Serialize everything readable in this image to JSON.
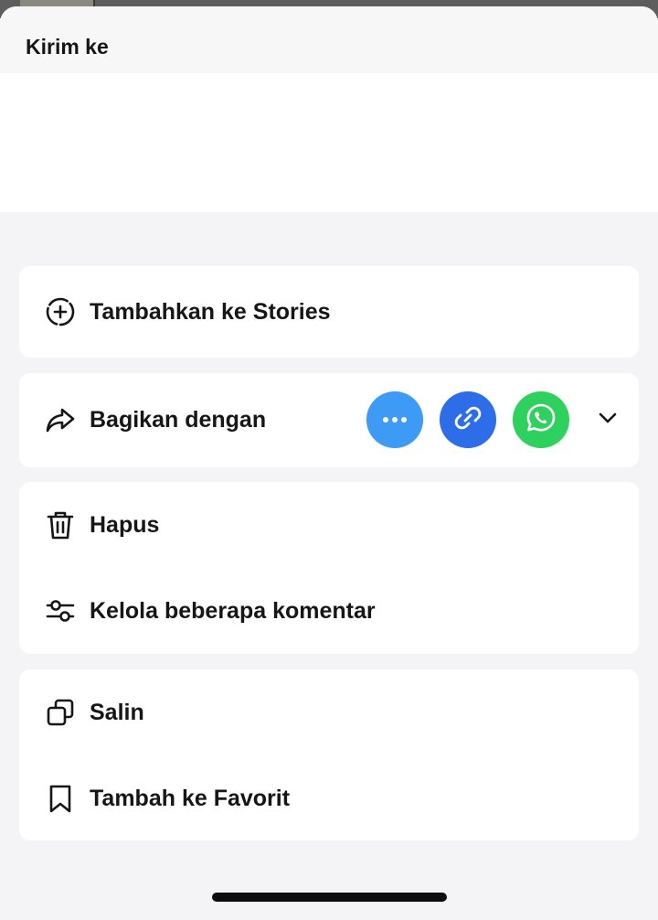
{
  "sheet": {
    "title": "Kirim ke"
  },
  "menu": {
    "add_to_stories": "Tambahkan ke Stories",
    "share_with": "Bagikan dengan",
    "delete": "Hapus",
    "manage_comments": "Kelola beberapa komentar",
    "copy": "Salin",
    "add_to_favorites": "Tambah ke Favorit"
  },
  "share_targets": [
    {
      "name": "more",
      "icon": "more-dots-icon",
      "color": "#3d9af5"
    },
    {
      "name": "copy-link",
      "icon": "link-icon",
      "color": "#2d6ee8"
    },
    {
      "name": "whatsapp",
      "icon": "whatsapp-icon",
      "color": "#2ed15d"
    }
  ],
  "colors": {
    "background": "#f4f4f6",
    "card": "#ffffff",
    "text": "#161616"
  }
}
